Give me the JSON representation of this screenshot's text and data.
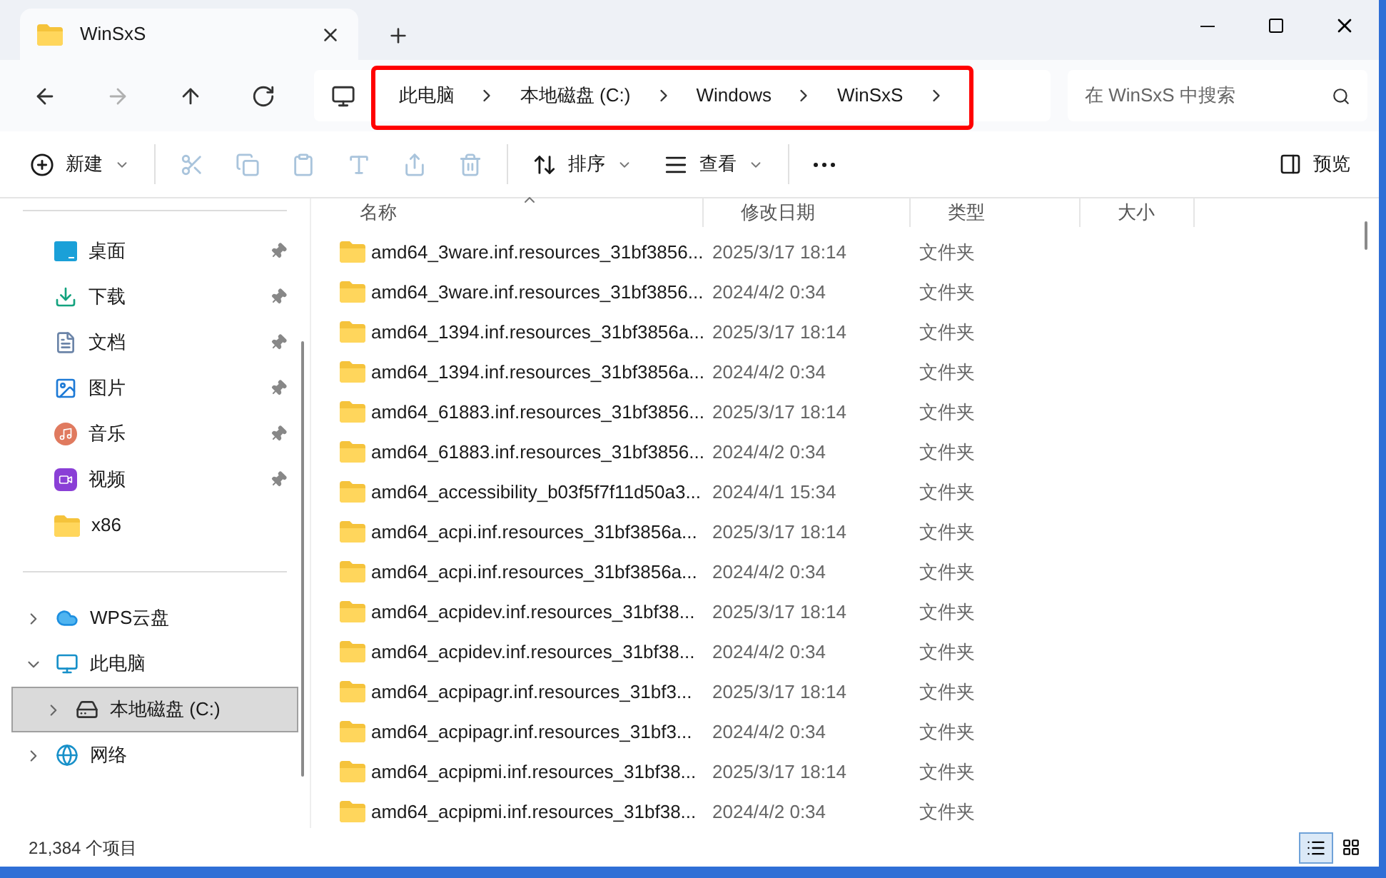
{
  "tab": {
    "title": "WinSxS"
  },
  "nav": [
    {
      "kind": "back",
      "disabled": false
    },
    {
      "kind": "forward",
      "disabled": true
    },
    {
      "kind": "up",
      "disabled": false
    },
    {
      "kind": "refresh",
      "disabled": false
    }
  ],
  "breadcrumb": [
    "此电脑",
    "本地磁盘 (C:)",
    "Windows",
    "WinSxS"
  ],
  "search": {
    "placeholder": "在 WinSxS 中搜索"
  },
  "toolbar": [
    {
      "kind": "new",
      "label": "新建",
      "disabled": false
    },
    {
      "kind": "cut",
      "disabled": true
    },
    {
      "kind": "copy",
      "disabled": true
    },
    {
      "kind": "paste",
      "disabled": true
    },
    {
      "kind": "rename",
      "disabled": true
    },
    {
      "kind": "share",
      "disabled": true
    },
    {
      "kind": "delete",
      "disabled": true
    },
    {
      "kind": "sort",
      "label": "排序",
      "disabled": false
    },
    {
      "kind": "view",
      "label": "查看",
      "disabled": false
    },
    {
      "kind": "more",
      "disabled": false
    }
  ],
  "preview_button": {
    "label": "预览"
  },
  "quick_access": [
    {
      "kind": "desktop",
      "label": "桌面",
      "pinned": true
    },
    {
      "kind": "download",
      "label": "下载",
      "pinned": true
    },
    {
      "kind": "documents",
      "label": "文档",
      "pinned": true
    },
    {
      "kind": "pictures",
      "label": "图片",
      "pinned": true
    },
    {
      "kind": "music",
      "label": "音乐",
      "pinned": true
    },
    {
      "kind": "videos",
      "label": "视频",
      "pinned": true
    },
    {
      "kind": "folder",
      "label": "x86",
      "pinned": false
    }
  ],
  "tree": [
    {
      "kind": "cloud",
      "label": "WPS云盘",
      "expanded": false,
      "selected": false
    },
    {
      "kind": "pc",
      "label": "此电脑",
      "expanded": true,
      "selected": false,
      "children": [
        {
          "kind": "drive",
          "label": "本地磁盘 (C:)",
          "expanded": false,
          "selected": true
        }
      ]
    },
    {
      "kind": "network",
      "label": "网络",
      "expanded": false,
      "selected": false
    }
  ],
  "table": {
    "columns": [
      {
        "label": "名称",
        "sorted": true
      },
      {
        "label": "修改日期",
        "sorted": false
      },
      {
        "label": "类型",
        "sorted": false
      },
      {
        "label": "大小",
        "sorted": false
      }
    ],
    "rows": [
      [
        "amd64_3ware.inf.resources_31bf3856...",
        "2025/3/17 18:14",
        "文件夹"
      ],
      [
        "amd64_3ware.inf.resources_31bf3856...",
        "2024/4/2 0:34",
        "文件夹"
      ],
      [
        "amd64_1394.inf.resources_31bf3856a...",
        "2025/3/17 18:14",
        "文件夹"
      ],
      [
        "amd64_1394.inf.resources_31bf3856a...",
        "2024/4/2 0:34",
        "文件夹"
      ],
      [
        "amd64_61883.inf.resources_31bf3856...",
        "2025/3/17 18:14",
        "文件夹"
      ],
      [
        "amd64_61883.inf.resources_31bf3856...",
        "2024/4/2 0:34",
        "文件夹"
      ],
      [
        "amd64_accessibility_b03f5f7f11d50a3...",
        "2024/4/1 15:34",
        "文件夹"
      ],
      [
        "amd64_acpi.inf.resources_31bf3856a...",
        "2025/3/17 18:14",
        "文件夹"
      ],
      [
        "amd64_acpi.inf.resources_31bf3856a...",
        "2024/4/2 0:34",
        "文件夹"
      ],
      [
        "amd64_acpidev.inf.resources_31bf38...",
        "2025/3/17 18:14",
        "文件夹"
      ],
      [
        "amd64_acpidev.inf.resources_31bf38...",
        "2024/4/2 0:34",
        "文件夹"
      ],
      [
        "amd64_acpipagr.inf.resources_31bf3...",
        "2025/3/17 18:14",
        "文件夹"
      ],
      [
        "amd64_acpipagr.inf.resources_31bf3...",
        "2024/4/2 0:34",
        "文件夹"
      ],
      [
        "amd64_acpipmi.inf.resources_31bf38...",
        "2025/3/17 18:14",
        "文件夹"
      ],
      [
        "amd64_acpipmi.inf.resources_31bf38...",
        "2024/4/2 0:34",
        "文件夹"
      ]
    ]
  },
  "status_bar": {
    "count": "21,384 个项目",
    "views": [
      {
        "kind": "details",
        "selected": true
      },
      {
        "kind": "tiles",
        "selected": false
      }
    ]
  }
}
